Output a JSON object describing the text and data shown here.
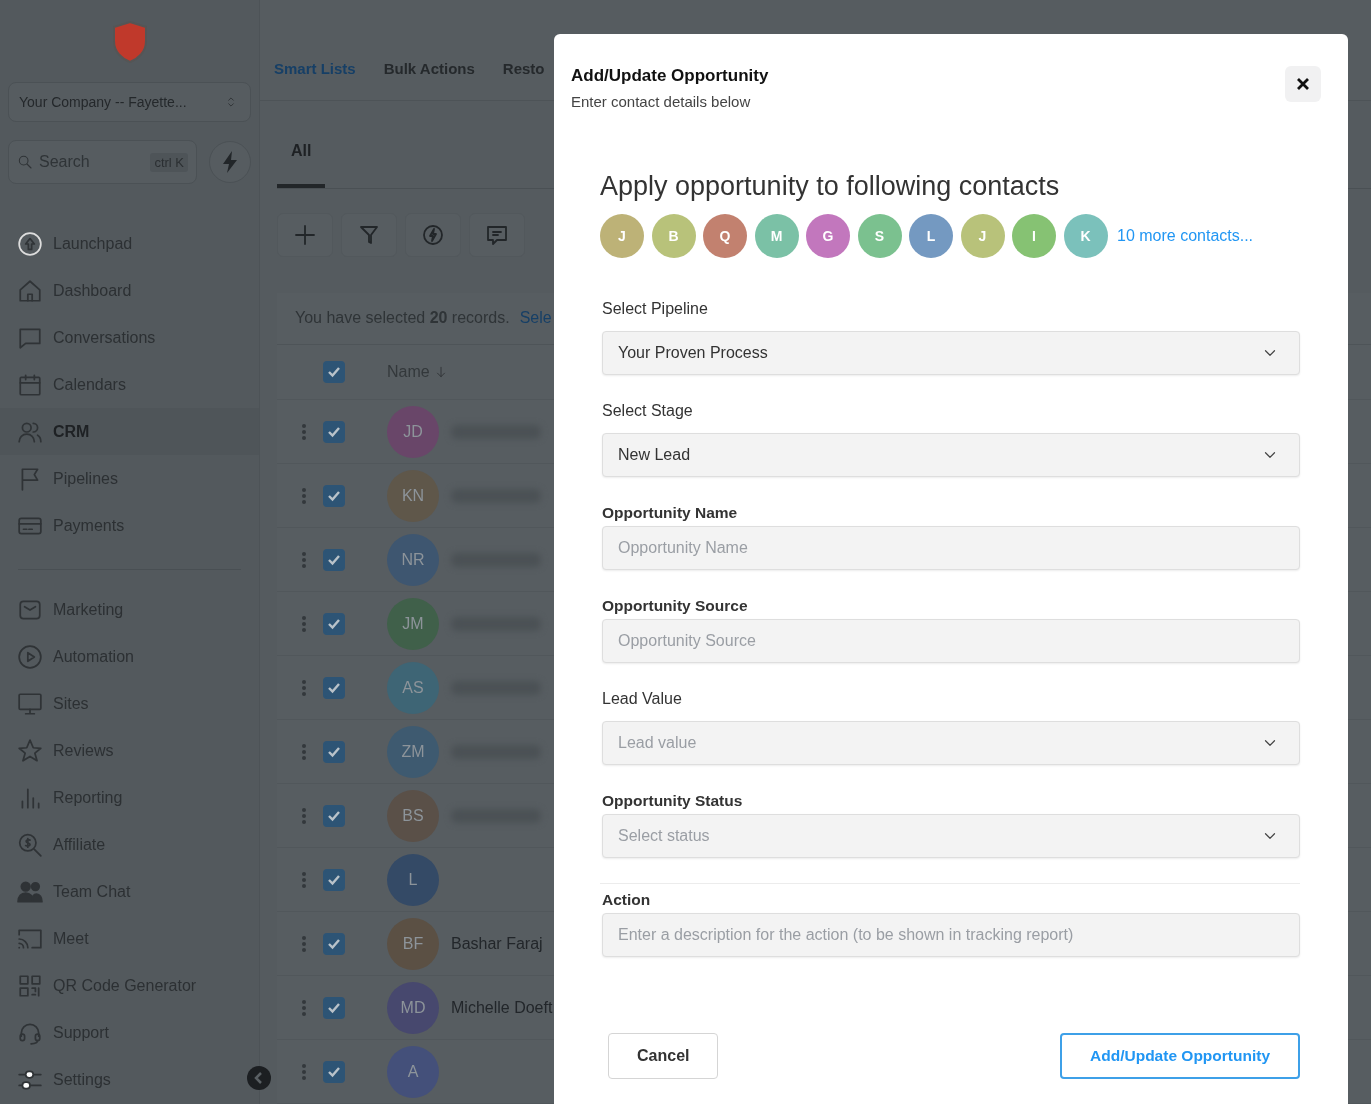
{
  "sidebar": {
    "company": "Your Company -- Fayette...",
    "search": {
      "placeholder": "Search",
      "shortcut": "ctrl K"
    },
    "items": [
      {
        "label": "Launchpad",
        "selected": false
      },
      {
        "label": "Dashboard",
        "selected": false
      },
      {
        "label": "Conversations",
        "selected": false
      },
      {
        "label": "Calendars",
        "selected": false
      },
      {
        "label": "CRM",
        "selected": true
      },
      {
        "label": "Pipelines",
        "selected": false
      },
      {
        "label": "Payments",
        "selected": false
      }
    ],
    "items_2": [
      {
        "label": "Marketing",
        "selected": false
      },
      {
        "label": "Automation",
        "selected": false
      },
      {
        "label": "Sites",
        "selected": false
      },
      {
        "label": "Reviews",
        "selected": false
      },
      {
        "label": "Reporting",
        "selected": false
      },
      {
        "label": "Affiliate",
        "selected": false
      },
      {
        "label": "Team Chat",
        "selected": false
      },
      {
        "label": "Meet",
        "selected": false
      },
      {
        "label": "QR Code Generator",
        "selected": false
      },
      {
        "label": "Support",
        "selected": false
      }
    ],
    "settings": "Settings"
  },
  "top_tabs": [
    {
      "label": "Smart Lists",
      "selected": true
    },
    {
      "label": "Bulk Actions",
      "selected": false
    },
    {
      "label": "Resto",
      "selected": false
    }
  ],
  "list_tabs": [
    {
      "label": "All",
      "selected": true
    }
  ],
  "selection_notice": {
    "text": "You have selected **20** records.",
    "link": "Sele"
  },
  "table": {
    "header_checked": true,
    "column_1": "Name",
    "rows": [
      {
        "initials": "JD",
        "color": "#694669",
        "checked": true,
        "blurred": true
      },
      {
        "initials": "KN",
        "color": "#5f574a",
        "checked": true,
        "blurred": true
      },
      {
        "initials": "NR",
        "color": "#3e5670",
        "checked": true,
        "blurred": true
      },
      {
        "initials": "JM",
        "color": "#40604a",
        "checked": true,
        "blurred": true
      },
      {
        "initials": "AS",
        "color": "#3e6575",
        "checked": true,
        "blurred": true
      },
      {
        "initials": "ZM",
        "color": "#3e5a70",
        "checked": true,
        "blurred": true
      },
      {
        "initials": "BS",
        "color": "#5a5048",
        "checked": true,
        "blurred": true
      },
      {
        "initials": "L",
        "color": "#344a66",
        "checked": true,
        "blurred": false
      },
      {
        "initials": "BF",
        "color": "#5b5044",
        "checked": true,
        "blurred": false,
        "name": "Bashar Faraj"
      },
      {
        "initials": "MD",
        "color": "#47486e",
        "checked": true,
        "blurred": false,
        "name": "Michelle Doeft"
      },
      {
        "initials": "A",
        "color": "#44507a",
        "checked": true,
        "blurred": false
      }
    ]
  },
  "modal": {
    "title": "Add/Update Opportunity",
    "subtitle": "Enter contact details below",
    "heading": "Apply opportunity to following contacts",
    "contacts": [
      {
        "initial": "J",
        "color": "#bdb277"
      },
      {
        "initial": "B",
        "color": "#b8c27a"
      },
      {
        "initial": "Q",
        "color": "#c2816f"
      },
      {
        "initial": "M",
        "color": "#7bc1a6"
      },
      {
        "initial": "G",
        "color": "#c277bd"
      },
      {
        "initial": "S",
        "color": "#7bc18f"
      },
      {
        "initial": "L",
        "color": "#7499c1"
      },
      {
        "initial": "J",
        "color": "#b8c27a"
      },
      {
        "initial": "I",
        "color": "#86c273"
      },
      {
        "initial": "K",
        "color": "#7bc1bb"
      }
    ],
    "more_link": "10 more contacts...",
    "fields": [
      {
        "kind": "select",
        "label": "Select Pipeline",
        "bold": false,
        "value": "Your Proven Process"
      },
      {
        "kind": "select",
        "label": "Select Stage",
        "bold": false,
        "value": "New Lead"
      },
      {
        "kind": "input",
        "label": "Opportunity Name",
        "bold": true,
        "placeholder": "Opportunity Name"
      },
      {
        "kind": "input",
        "label": "Opportunity Source",
        "bold": true,
        "placeholder": "Opportunity Source"
      },
      {
        "kind": "select",
        "label": "Lead Value",
        "bold": false,
        "placeholder": "Lead value"
      },
      {
        "kind": "select",
        "label": "Opportunity Status",
        "bold": true,
        "placeholder": "Select status"
      },
      {
        "kind": "input",
        "label": "Action",
        "bold": true,
        "divider": true,
        "placeholder": "Enter a description for the action (to be shown in tracking report)"
      }
    ],
    "cancel": "Cancel",
    "submit": "Add/Update Opportunity"
  }
}
